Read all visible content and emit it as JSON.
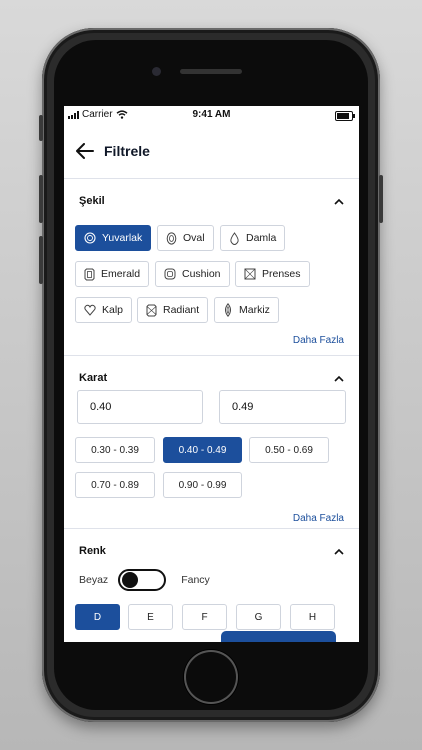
{
  "status_bar": {
    "carrier": "Carrier",
    "time": "9:41 AM"
  },
  "header": {
    "title": "Filtrele",
    "back_icon": "arrow-left-icon"
  },
  "shape": {
    "title": "Şekil",
    "options": [
      {
        "label": "Yuvarlak",
        "icon": "round-diamond-icon",
        "selected": true
      },
      {
        "label": "Oval",
        "icon": "oval-diamond-icon",
        "selected": false
      },
      {
        "label": "Damla",
        "icon": "pear-diamond-icon",
        "selected": false
      },
      {
        "label": "Emerald",
        "icon": "emerald-diamond-icon",
        "selected": false
      },
      {
        "label": "Cushion",
        "icon": "cushion-diamond-icon",
        "selected": false
      },
      {
        "label": "Prenses",
        "icon": "princess-diamond-icon",
        "selected": false
      },
      {
        "label": "Kalp",
        "icon": "heart-diamond-icon",
        "selected": false
      },
      {
        "label": "Radiant",
        "icon": "radiant-diamond-icon",
        "selected": false
      },
      {
        "label": "Markiz",
        "icon": "marquise-diamond-icon",
        "selected": false
      }
    ],
    "more_label": "Daha Fazla"
  },
  "carat": {
    "title": "Karat",
    "min_value": "0.40",
    "max_value": "0.49",
    "ranges": [
      {
        "label": "0.30 - 0.39",
        "selected": false
      },
      {
        "label": "0.40 - 0.49",
        "selected": true
      },
      {
        "label": "0.50 - 0.69",
        "selected": false
      },
      {
        "label": "0.70 - 0.89",
        "selected": false
      },
      {
        "label": "0.90 - 0.99",
        "selected": false
      }
    ],
    "more_label": "Daha Fazla"
  },
  "color": {
    "title": "Renk",
    "toggle_left": "Beyaz",
    "toggle_right": "Fancy",
    "toggle_on": false,
    "grades": [
      {
        "label": "D",
        "selected": true
      },
      {
        "label": "E",
        "selected": false
      },
      {
        "label": "F",
        "selected": false
      },
      {
        "label": "G",
        "selected": false
      },
      {
        "label": "H",
        "selected": false
      }
    ]
  },
  "colors": {
    "accent": "#1c4f9c",
    "border": "#cfd4dd"
  }
}
